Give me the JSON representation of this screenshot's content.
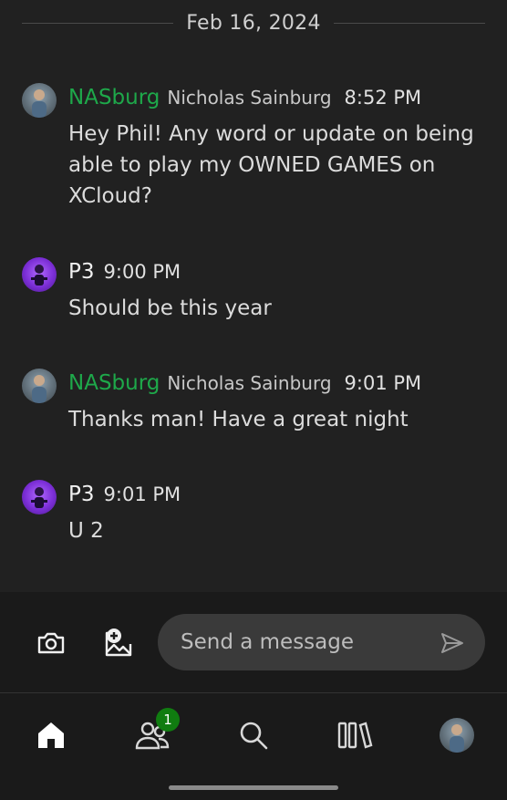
{
  "date_divider": "Feb 16, 2024",
  "messages": [
    {
      "gamertag": "NASburg",
      "real_name": "Nicholas Sainburg",
      "time": "8:52 PM",
      "lines": [
        "Hey Phil! Any word or update on being",
        "able to play my OWNED GAMES on",
        "XCloud?"
      ]
    },
    {
      "gamertag": "P3",
      "real_name": "",
      "time": "9:00 PM",
      "lines": [
        "Should be this year"
      ]
    },
    {
      "gamertag": "NASburg",
      "real_name": "Nicholas Sainburg",
      "time": "9:01 PM",
      "lines": [
        "Thanks man! Have a great night"
      ]
    },
    {
      "gamertag": "P3",
      "real_name": "",
      "time": "9:01 PM",
      "lines": [
        "U 2"
      ]
    }
  ],
  "composer": {
    "placeholder": "Send a message",
    "camera_icon": "camera-icon",
    "add_image_icon": "add-image-icon",
    "send_icon": "send-icon"
  },
  "nav": {
    "items": [
      "home-icon",
      "friends-icon",
      "search-icon",
      "library-icon",
      "profile-avatar"
    ],
    "friends_badge": "1"
  },
  "colors": {
    "background": "#212121",
    "gamertag_green": "#1ea84a",
    "badge_green": "#107c10",
    "input_bg": "#3a3a3a"
  }
}
